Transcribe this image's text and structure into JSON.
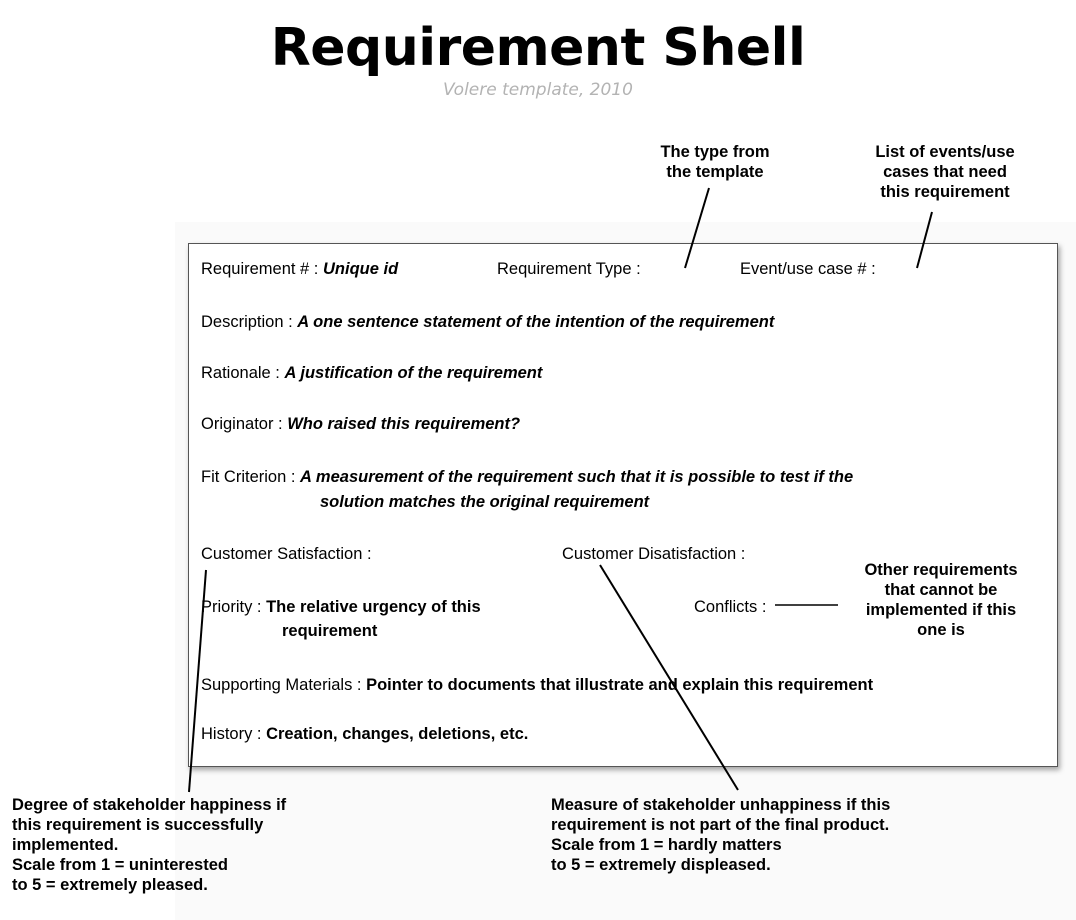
{
  "header": {
    "title": "Requirement Shell",
    "subtitle": "Volere template, 2010"
  },
  "callouts": {
    "type_from_template": [
      "The type from",
      "the template"
    ],
    "events_use_cases": [
      "List of events/use",
      "cases that need",
      "this requirement"
    ],
    "other_requirements": [
      "Other requirements",
      "that cannot be",
      "implemented if this",
      "one is"
    ],
    "stakeholder_happiness": [
      "Degree of stakeholder happiness if",
      "this requirement is successfully",
      "implemented.",
      "Scale from 1 = uninterested",
      "to 5 = extremely pleased."
    ],
    "stakeholder_unhappiness": [
      "Measure of stakeholder unhappiness if this",
      "requirement is not part of the final product.",
      "Scale from 1 = hardly matters",
      "to 5 = extremely displeased."
    ]
  },
  "card": {
    "requirement_num_label": "Requirement # : ",
    "requirement_num_value": "Unique id",
    "requirement_type_label": "Requirement Type :",
    "event_use_case_label": "Event/use case # :",
    "description_label": "Description : ",
    "description_value": "A one sentence statement of the intention of the requirement",
    "rationale_label": "Rationale : ",
    "rationale_value": "A justification of the requirement",
    "originator_label": "Originator : ",
    "originator_value": "Who raised this requirement?",
    "fit_label": "Fit Criterion : ",
    "fit_value_1": "A measurement of the requirement such that it is possible to test if the",
    "fit_value_2": "solution matches the original requirement",
    "customer_satisfaction_label": "Customer Satisfaction :",
    "customer_dissatisfaction_label": "Customer Disatisfaction :",
    "priority_label": "Priority : ",
    "priority_value_1": "The relative urgency of this",
    "priority_value_2": "requirement",
    "conflicts_label": "Conflicts :",
    "supporting_label": "Supporting Materials : ",
    "supporting_value": "Pointer to documents that illustrate and explain this requirement",
    "history_label": "History : ",
    "history_value": "Creation, changes, deletions, etc."
  }
}
